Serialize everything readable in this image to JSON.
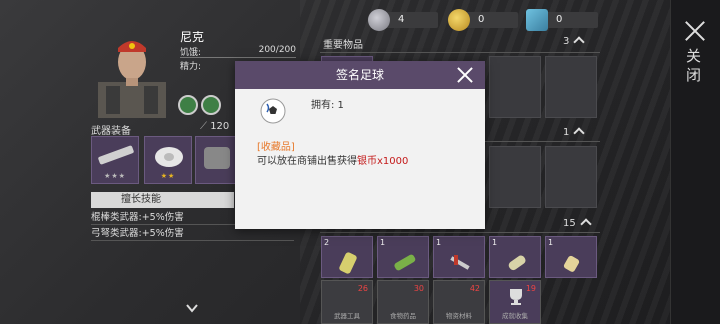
{
  "currency": [
    {
      "name": "silver-coins",
      "value": "4",
      "color": "#9a9aa4"
    },
    {
      "name": "gold-coin",
      "value": "0",
      "color": "#d9b340"
    },
    {
      "name": "map-ticket",
      "value": "0",
      "color": "#4da3c7"
    }
  ],
  "close_panel": {
    "label": "关闭"
  },
  "character": {
    "name": "尼克",
    "hunger_label": "饥饿:",
    "hunger_value": "200/200",
    "energy_label": "精力:",
    "weapons_title": "武器装备",
    "weapons_count": "120",
    "weapon_slots": [
      {
        "name": "rifle",
        "stars": "★★★"
      },
      {
        "name": "bandage",
        "stars": "★★"
      },
      {
        "name": "armor",
        "stars": ""
      }
    ],
    "skills_tab": "擅长技能",
    "skills": [
      "棍棒类武器:+5%伤害",
      "弓弩类武器:+5%伤害"
    ]
  },
  "inventory": {
    "sections": [
      {
        "title": "重要物品",
        "count": "3"
      },
      {
        "title": "",
        "count": "1"
      },
      {
        "title": "",
        "count": "15"
      }
    ],
    "bottom_row": [
      {
        "count": "2",
        "item": "drink-can"
      },
      {
        "count": "1",
        "item": "herb-bundle"
      },
      {
        "count": "1",
        "item": "tool-pipe"
      },
      {
        "count": "1",
        "item": "cloth-roll"
      },
      {
        "count": "1",
        "item": "bandage-roll"
      }
    ],
    "tabs": [
      {
        "label": "武器工具",
        "badge": "26"
      },
      {
        "label": "食物药品",
        "badge": "30"
      },
      {
        "label": "物资材料",
        "badge": "42"
      },
      {
        "label": "成就收集",
        "badge": "19"
      }
    ]
  },
  "modal": {
    "title": "签名足球",
    "owned": "拥有: 1",
    "tag": "[收藏品]",
    "desc_prefix": "可以放在商铺出售获得",
    "desc_highlight": "银币x1000"
  }
}
